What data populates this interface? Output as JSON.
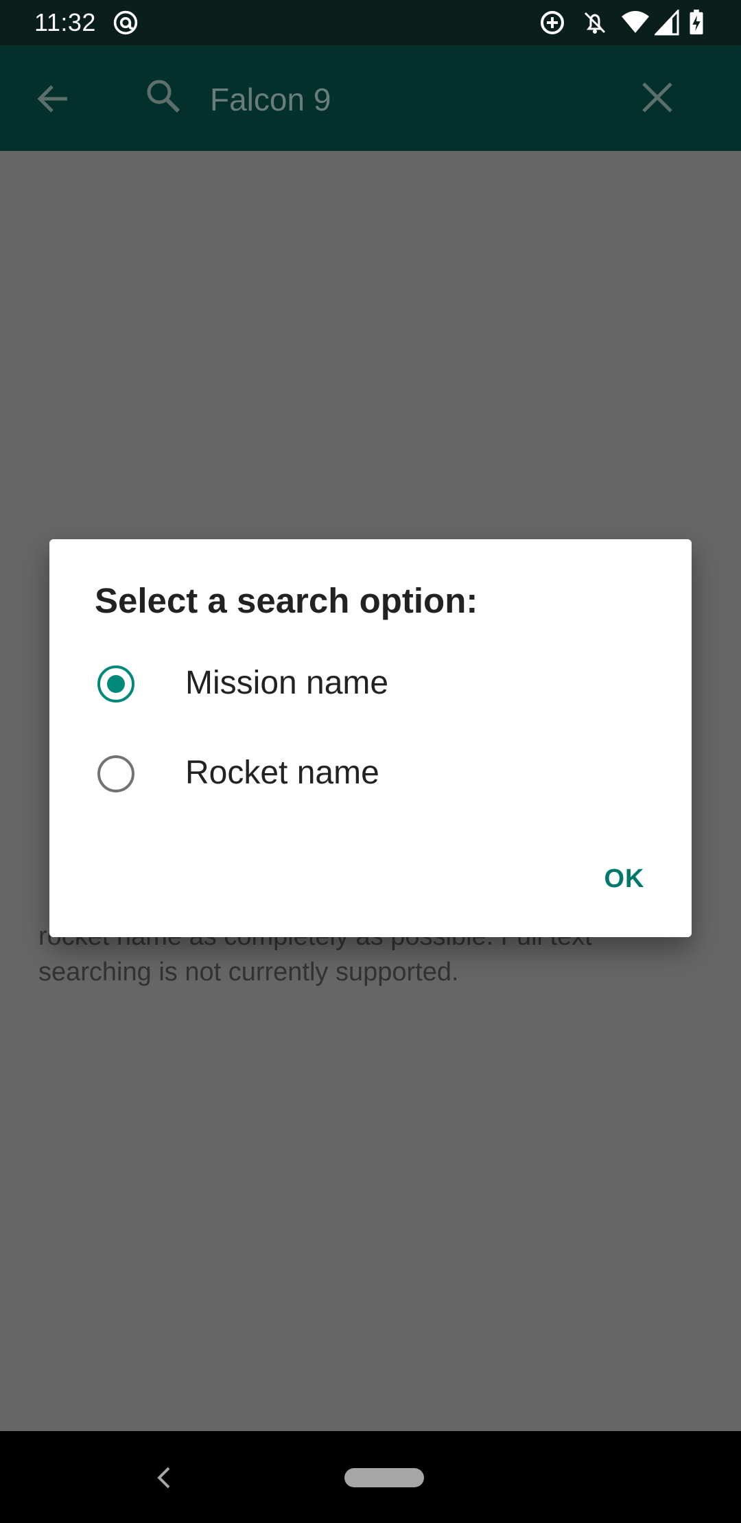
{
  "status_bar": {
    "time": "11:32",
    "icons": [
      "at-sign-icon",
      "data-saver-icon",
      "notifications-off-icon",
      "wifi-icon",
      "signal-icon",
      "battery-charging-icon"
    ]
  },
  "toolbar": {
    "search_value": "Falcon 9",
    "icons": [
      "back-arrow-icon",
      "search-icon",
      "close-icon"
    ]
  },
  "background_text": {
    "line1": "rocket name as completely as possible. Full text",
    "line2": "searching is not currently supported."
  },
  "dialog": {
    "title": "Select a search option:",
    "options": [
      {
        "label": "Mission name",
        "selected": true
      },
      {
        "label": "Rocket name",
        "selected": false
      }
    ],
    "ok_label": "OK"
  },
  "colors": {
    "accent": "#00897b",
    "toolbar": "#03302b",
    "scrim": "#666666"
  }
}
